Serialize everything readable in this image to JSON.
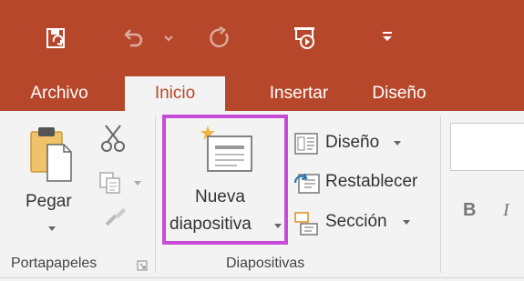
{
  "tabs": {
    "file": "Archivo",
    "home": "Inicio",
    "insert": "Insertar",
    "design": "Diseño"
  },
  "clipboard": {
    "paste_label": "Pegar",
    "group_label": "Portapapeles"
  },
  "slides": {
    "new_slide_line1": "Nueva",
    "new_slide_line2": "diapositiva",
    "layout_label": "Diseño",
    "reset_label": "Restablecer",
    "section_label": "Sección",
    "group_label": "Diapositivas"
  },
  "font": {
    "bold": "B",
    "italic": "I"
  },
  "colors": {
    "ribbon_red": "#b7472a",
    "highlight": "#c74bd6"
  }
}
